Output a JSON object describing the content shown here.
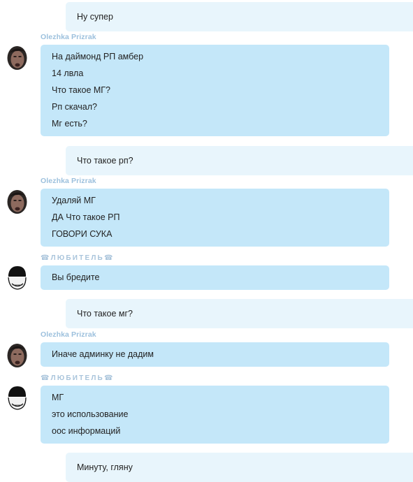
{
  "messages": [
    {
      "type": "out",
      "lines": [
        "Ну супер"
      ]
    },
    {
      "type": "in",
      "sender": "Olezhka Prizrak",
      "avatar": "man-face-avatar",
      "lines": [
        "На даймонд РП амбер",
        "14 лвла",
        "Что такое МГ?",
        "Рп скачал?",
        "Мг есть?"
      ]
    },
    {
      "type": "out",
      "lines": [
        "Что такое рп?"
      ]
    },
    {
      "type": "in",
      "sender": "Olezhka Prizrak",
      "avatar": "man-face-avatar",
      "lines": [
        "Удаляй МГ",
        "ДА Что такое РП",
        "ГОВОРИ СУКА"
      ]
    },
    {
      "type": "in",
      "sender": "☎ЛЮБИТЕЛЬ☎",
      "avatar": "troll-face-avatar",
      "lines": [
        "Вы бредите"
      ]
    },
    {
      "type": "out",
      "lines": [
        "Что такое мг?"
      ]
    },
    {
      "type": "in",
      "sender": "Olezhka Prizrak",
      "avatar": "man-face-avatar",
      "lines": [
        "Иначе админку не дадим"
      ]
    },
    {
      "type": "in",
      "sender": "☎ЛЮБИТЕЛЬ☎",
      "avatar": "troll-face-avatar",
      "lines": [
        "МГ",
        "это использование",
        "оос информаций"
      ]
    },
    {
      "type": "out",
      "lines": [
        "Минуту, гляну"
      ]
    }
  ],
  "colors": {
    "incoming_bubble": "#c4e7f9",
    "outgoing_bubble": "#e8f5fc",
    "sender_name": "#9cc0dd"
  }
}
